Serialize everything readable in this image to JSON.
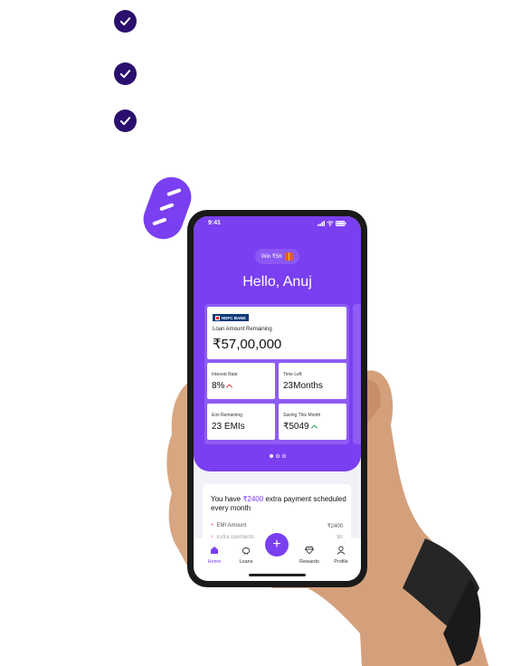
{
  "colors": {
    "accent": "#7a3ff0",
    "check_bg": "#2a0f6e",
    "card_bg": "#8f5cf4",
    "hdfc_blue": "#0d3a7a"
  },
  "checks": [
    "check-icon",
    "check-icon",
    "check-icon"
  ],
  "status_bar": {
    "time": "9:41"
  },
  "header": {
    "win_label": "Win ₹5K",
    "greeting": "Hello, Anuj"
  },
  "loan_card": {
    "bank_name": "HDFC BANK",
    "loan_label": "Loan Amount Remaining",
    "loan_value": "₹57,00,000",
    "stats": [
      {
        "label": "Interest Rate",
        "value": "8%",
        "trend": "up",
        "trend_color": "#e04040"
      },
      {
        "label": "Time Left",
        "value": "23Months"
      },
      {
        "label": "Emi Remaining",
        "value": "23 EMIs"
      },
      {
        "label": "Saving This Month",
        "value": "₹5049",
        "trend": "up",
        "trend_color": "#2aa65a"
      }
    ]
  },
  "pager": {
    "count": 3,
    "active": 1
  },
  "extra_payment": {
    "prefix": "You have",
    "amount": "₹2400",
    "suffix": "extra payment scheduled every month",
    "rows": [
      {
        "label": "EMI Amount",
        "value": "₹2400"
      },
      {
        "label": "Extra payments",
        "value": "$0"
      }
    ]
  },
  "nav": {
    "items": [
      {
        "label": "Home",
        "icon": "home-icon",
        "active": true
      },
      {
        "label": "Loans",
        "icon": "piggy-bank-icon"
      },
      {
        "label": "Rewards",
        "icon": "diamond-icon"
      },
      {
        "label": "Profile",
        "icon": "user-icon"
      }
    ],
    "fab_icon": "plus-icon",
    "fab_glyph": "+"
  }
}
